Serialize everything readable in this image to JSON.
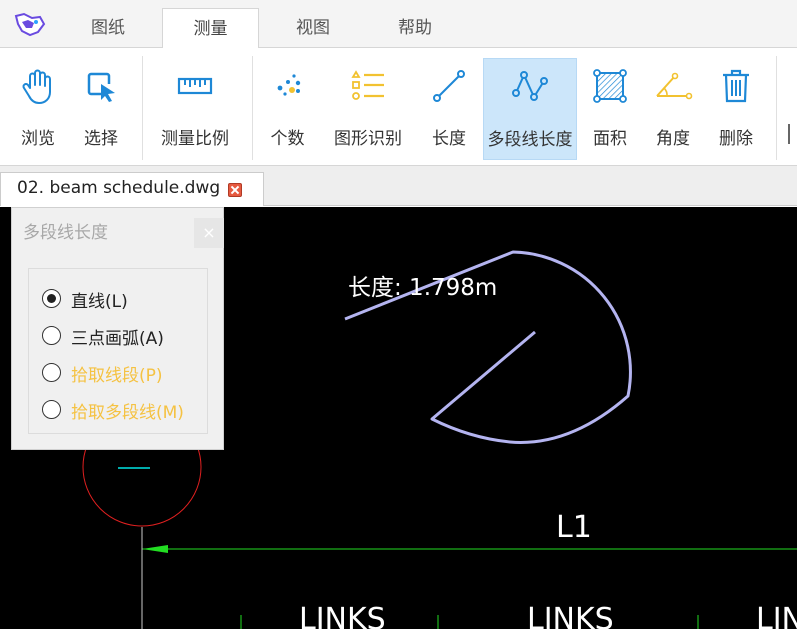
{
  "menu": {
    "tabs": [
      {
        "label": "图纸"
      },
      {
        "label": "测量"
      },
      {
        "label": "视图"
      },
      {
        "label": "帮助"
      }
    ],
    "active_tab": "测量"
  },
  "ribbon": {
    "tools": [
      {
        "label": "浏览",
        "icon": "hand-icon"
      },
      {
        "label": "选择",
        "icon": "pointer-select-icon"
      },
      {
        "label": "测量比例",
        "icon": "ruler-icon"
      },
      {
        "label": "个数",
        "icon": "dots-count-icon"
      },
      {
        "label": "图形识别",
        "icon": "list-shapes-icon"
      },
      {
        "label": "长度",
        "icon": "line-length-icon"
      },
      {
        "label": "多段线长度",
        "icon": "polyline-icon"
      },
      {
        "label": "面积",
        "icon": "area-icon"
      },
      {
        "label": "角度",
        "icon": "angle-icon"
      },
      {
        "label": "删除",
        "icon": "trash-icon"
      }
    ],
    "active_tool": "多段线长度"
  },
  "file_tab": {
    "name": "02. beam schedule.dwg"
  },
  "panel": {
    "title": "多段线长度",
    "close": "×",
    "options": [
      {
        "label": "直线(L)",
        "selected": true,
        "color": "#222222"
      },
      {
        "label": "三点画弧(A)",
        "selected": false,
        "color": "#222222"
      },
      {
        "label": "拾取线段(P)",
        "selected": false,
        "color": "#f5c242"
      },
      {
        "label": "拾取多段线(M)",
        "selected": false,
        "color": "#f5c242"
      }
    ]
  },
  "canvas": {
    "measurement_label": "长度: 1.798m",
    "beam_label": "L1",
    "links_labels": [
      "LINKS",
      "LINKS",
      "LIN"
    ],
    "colors": {
      "background": "#000000",
      "polyline": "#b4b4f0",
      "circle": "#e02020",
      "dimension": "#22dd22",
      "text": "#ffffff"
    }
  },
  "colors": {
    "accent": "#1e88d6",
    "active_tool_bg": "#cce6fa",
    "yellow_icon": "#f2c230"
  }
}
